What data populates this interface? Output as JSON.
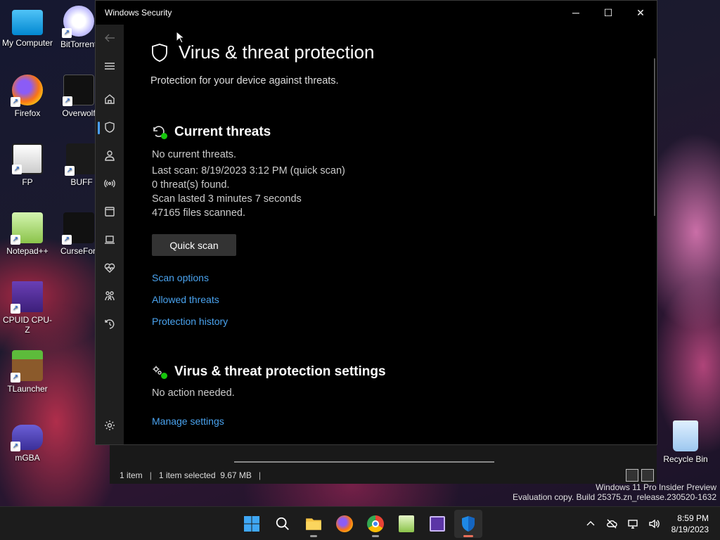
{
  "desktop": {
    "icons": [
      {
        "label": "My Computer",
        "icon": "computer-icon"
      },
      {
        "label": "BitTorrent Web",
        "icon": "bittorrent-icon"
      },
      {
        "label": "Firefox",
        "icon": "firefox-icon"
      },
      {
        "label": "Overwolf",
        "icon": "overwolf-icon"
      },
      {
        "label": "FP",
        "icon": "fp-icon"
      },
      {
        "label": "BUFF",
        "icon": "buff-icon"
      },
      {
        "label": "Notepad++",
        "icon": "notepadpp-icon"
      },
      {
        "label": "CurseForge",
        "icon": "curseforge-icon"
      },
      {
        "label": "CPUID CPU-Z",
        "icon": "cpuz-icon"
      },
      {
        "label": "TLauncher",
        "icon": "tlauncher-icon"
      },
      {
        "label": "mGBA",
        "icon": "mgba-icon"
      },
      {
        "label": "Recycle Bin",
        "icon": "recycle-bin-icon"
      }
    ]
  },
  "explorer": {
    "items_count": "1 item",
    "selected": "1 item selected  9.67 MB"
  },
  "watermark": {
    "line1": "Windows 11 Pro Insider Preview",
    "line2": "Evaluation copy. Build 25375.zn_release.230520-1632"
  },
  "window": {
    "title": "Windows Security",
    "controls": {
      "minimize": "─",
      "maximize": "☐",
      "close": "✕"
    }
  },
  "nav": {
    "items": [
      {
        "name": "back",
        "icon": "back-arrow-icon"
      },
      {
        "name": "menu",
        "icon": "hamburger-icon"
      },
      {
        "name": "home",
        "icon": "home-icon"
      },
      {
        "name": "virus-protection",
        "icon": "shield-icon",
        "selected": true
      },
      {
        "name": "account-protection",
        "icon": "person-icon"
      },
      {
        "name": "firewall",
        "icon": "wifi-antenna-icon"
      },
      {
        "name": "app-browser-control",
        "icon": "browser-window-icon"
      },
      {
        "name": "device-security",
        "icon": "laptop-icon"
      },
      {
        "name": "device-performance",
        "icon": "heart-pulse-icon"
      },
      {
        "name": "family-options",
        "icon": "family-icon"
      },
      {
        "name": "protection-history",
        "icon": "history-icon"
      },
      {
        "name": "settings",
        "icon": "gear-icon"
      }
    ],
    "accent": "#4aa0ff"
  },
  "page": {
    "title": "Virus & threat protection",
    "subtitle": "Protection for your device against threats.",
    "current_threats": {
      "title": "Current threats",
      "lines": [
        "No current threats.",
        "Last scan: 8/19/2023 3:12 PM (quick scan)",
        "0 threat(s) found.",
        "Scan lasted 3 minutes 7 seconds",
        "47165 files scanned."
      ],
      "button": "Quick scan",
      "links": [
        "Scan options",
        "Allowed threats",
        "Protection history"
      ]
    },
    "settings": {
      "title": "Virus & threat protection settings",
      "status": "No action needed.",
      "link": "Manage settings"
    },
    "link_color": "#4aa3ef",
    "ok_color": "#16c60c"
  },
  "taskbar": {
    "apps": [
      {
        "name": "start",
        "icon": "windows-logo-icon"
      },
      {
        "name": "search",
        "icon": "search-icon"
      },
      {
        "name": "file-explorer",
        "icon": "folder-icon"
      },
      {
        "name": "firefox",
        "icon": "firefox-icon"
      },
      {
        "name": "chrome",
        "icon": "chrome-icon"
      },
      {
        "name": "notepadpp",
        "icon": "notepadpp-icon"
      },
      {
        "name": "cpuz",
        "icon": "cpuz-icon"
      },
      {
        "name": "windows-security",
        "icon": "shield-icon",
        "active": true
      }
    ],
    "clock": {
      "time": "8:59 PM",
      "date": "8/19/2023"
    }
  }
}
